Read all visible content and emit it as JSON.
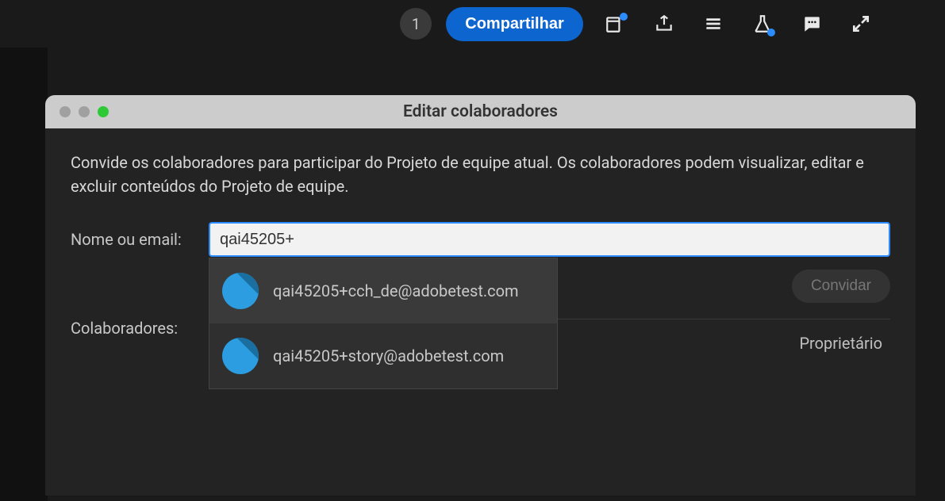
{
  "topbar": {
    "badge_count": "1",
    "share_label": "Compartilhar"
  },
  "dialog": {
    "title": "Editar colaboradores",
    "description": "Convide os colaboradores para participar do Projeto de equipe atual. Os colaboradores podem visualizar, editar e excluir conteúdos do Projeto de equipe.",
    "name_email_label": "Nome ou email:",
    "input_value": "qai45205+",
    "suggestions": [
      {
        "email": "qai45205+cch_de@adobetest.com"
      },
      {
        "email": "qai45205+story@adobetest.com"
      }
    ],
    "invite_label": "Convidar",
    "collab_label": "Colaboradores:",
    "owner_role": "Proprietário"
  }
}
